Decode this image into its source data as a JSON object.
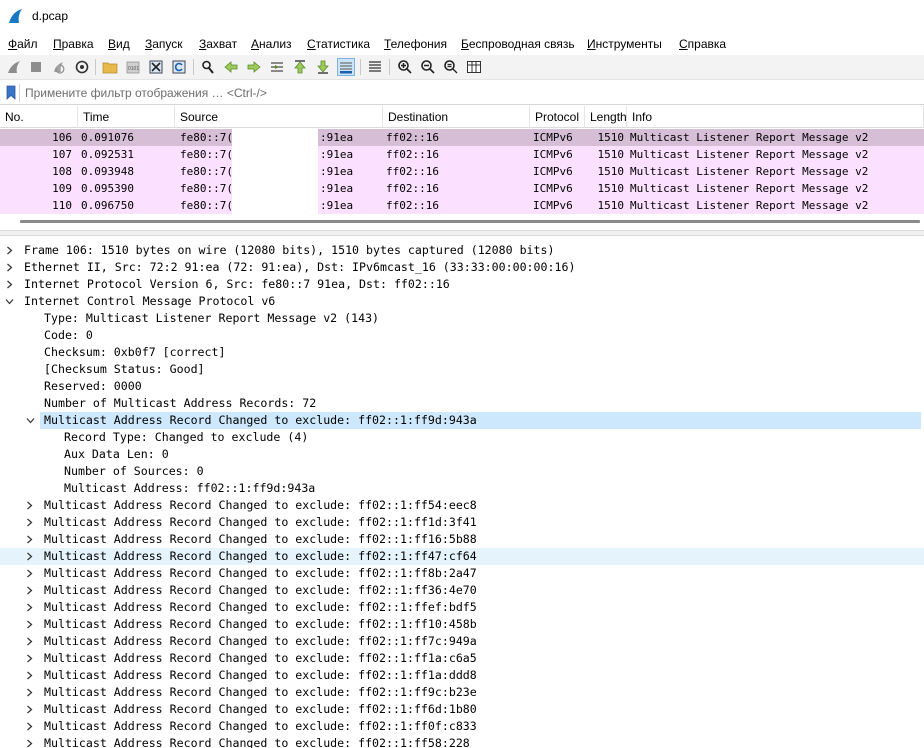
{
  "window": {
    "title": "d.pcap"
  },
  "menu": [
    "Файл",
    "Правка",
    "Вид",
    "Запуск",
    "Захват",
    "Анализ",
    "Статистика",
    "Телефония",
    "Беспроводная связь",
    "Инструменты",
    "Справка"
  ],
  "toolbar_icons": [
    "start-capture-icon",
    "stop-capture-icon",
    "restart-capture-icon",
    "capture-options-icon",
    "open-file-icon",
    "save-file-icon",
    "close-file-icon",
    "reload-file-icon",
    "find-packet-icon",
    "go-back-icon",
    "go-forward-icon",
    "go-to-packet-icon",
    "first-packet-icon",
    "last-packet-icon",
    "autoscroll-icon",
    "colorize-icon",
    "zoom-in-icon",
    "zoom-out-icon",
    "normal-size-icon",
    "resize-columns-icon"
  ],
  "filter": {
    "placeholder": "Примените фильтр отображения … <Ctrl-/>"
  },
  "packet_list": {
    "columns": [
      "No.",
      "Time",
      "Source",
      "Destination",
      "Protocol",
      "Length",
      "Info"
    ],
    "rows": [
      {
        "no": "106",
        "time": "0.091076",
        "source_start": "fe80::7(",
        "source_end": ":91ea",
        "destination": "ff02::16",
        "protocol": "ICMPv6",
        "length": "1510",
        "info": "Multicast Listener Report Message v2",
        "selected": true
      },
      {
        "no": "107",
        "time": "0.092531",
        "source_start": "fe80::7(",
        "source_end": ":91ea",
        "destination": "ff02::16",
        "protocol": "ICMPv6",
        "length": "1510",
        "info": "Multicast Listener Report Message v2",
        "selected": false
      },
      {
        "no": "108",
        "time": "0.093948",
        "source_start": "fe80::7(",
        "source_end": ":91ea",
        "destination": "ff02::16",
        "protocol": "ICMPv6",
        "length": "1510",
        "info": "Multicast Listener Report Message v2",
        "selected": false
      },
      {
        "no": "109",
        "time": "0.095390",
        "source_start": "fe80::7(",
        "source_end": ":91ea",
        "destination": "ff02::16",
        "protocol": "ICMPv6",
        "length": "1510",
        "info": "Multicast Listener Report Message v2",
        "selected": false
      },
      {
        "no": "110",
        "time": "0.096750",
        "source_start": "fe80::7(",
        "source_end": ":91ea",
        "destination": "ff02::16",
        "protocol": "ICMPv6",
        "length": "1510",
        "info": "Multicast Listener Report Message v2",
        "selected": false
      }
    ]
  },
  "details": [
    {
      "level": 0,
      "arrow": "right",
      "highlight": "",
      "text": "Frame 106: 1510 bytes on wire (12080 bits), 1510 bytes captured (12080 bits)"
    },
    {
      "level": 0,
      "arrow": "right",
      "highlight": "",
      "text": "Ethernet II, Src: 72:2           91:ea (72:           91:ea), Dst: IPv6mcast_16 (33:33:00:00:00:16)"
    },
    {
      "level": 0,
      "arrow": "right",
      "highlight": "",
      "text": "Internet Protocol Version 6, Src: fe80::7                  91ea, Dst: ff02::16"
    },
    {
      "level": 0,
      "arrow": "down",
      "highlight": "",
      "text": "Internet Control Message Protocol v6"
    },
    {
      "level": 1,
      "arrow": "",
      "highlight": "",
      "text": "Type: Multicast Listener Report Message v2 (143)"
    },
    {
      "level": 1,
      "arrow": "",
      "highlight": "",
      "text": "Code: 0"
    },
    {
      "level": 1,
      "arrow": "",
      "highlight": "",
      "text": "Checksum: 0xb0f7 [correct]"
    },
    {
      "level": 1,
      "arrow": "",
      "highlight": "",
      "text": "[Checksum Status: Good]"
    },
    {
      "level": 1,
      "arrow": "",
      "highlight": "",
      "text": "Reserved: 0000"
    },
    {
      "level": 1,
      "arrow": "",
      "highlight": "",
      "text": "Number of Multicast Address Records: 72"
    },
    {
      "level": 1,
      "arrow": "down",
      "highlight": "selected",
      "text": "Multicast Address Record Changed to exclude: ff02::1:ff9d:943a"
    },
    {
      "level": 2,
      "arrow": "",
      "highlight": "",
      "text": "Record Type: Changed to exclude (4)"
    },
    {
      "level": 2,
      "arrow": "",
      "highlight": "",
      "text": "Aux Data Len: 0"
    },
    {
      "level": 2,
      "arrow": "",
      "highlight": "",
      "text": "Number of Sources: 0"
    },
    {
      "level": 2,
      "arrow": "",
      "highlight": "",
      "text": "Multicast Address: ff02::1:ff9d:943a"
    },
    {
      "level": 1,
      "arrow": "right",
      "highlight": "",
      "text": "Multicast Address Record Changed to exclude: ff02::1:ff54:eec8"
    },
    {
      "level": 1,
      "arrow": "right",
      "highlight": "",
      "text": "Multicast Address Record Changed to exclude: ff02::1:ff1d:3f41"
    },
    {
      "level": 1,
      "arrow": "right",
      "highlight": "",
      "text": "Multicast Address Record Changed to exclude: ff02::1:ff16:5b88"
    },
    {
      "level": 1,
      "arrow": "right",
      "highlight": "hover",
      "text": "Multicast Address Record Changed to exclude: ff02::1:ff47:cf64"
    },
    {
      "level": 1,
      "arrow": "right",
      "highlight": "",
      "text": "Multicast Address Record Changed to exclude: ff02::1:ff8b:2a47"
    },
    {
      "level": 1,
      "arrow": "right",
      "highlight": "",
      "text": "Multicast Address Record Changed to exclude: ff02::1:ff36:4e70"
    },
    {
      "level": 1,
      "arrow": "right",
      "highlight": "",
      "text": "Multicast Address Record Changed to exclude: ff02::1:ffef:bdf5"
    },
    {
      "level": 1,
      "arrow": "right",
      "highlight": "",
      "text": "Multicast Address Record Changed to exclude: ff02::1:ff10:458b"
    },
    {
      "level": 1,
      "arrow": "right",
      "highlight": "",
      "text": "Multicast Address Record Changed to exclude: ff02::1:ff7c:949a"
    },
    {
      "level": 1,
      "arrow": "right",
      "highlight": "",
      "text": "Multicast Address Record Changed to exclude: ff02::1:ff1a:c6a5"
    },
    {
      "level": 1,
      "arrow": "right",
      "highlight": "",
      "text": "Multicast Address Record Changed to exclude: ff02::1:ff1a:ddd8"
    },
    {
      "level": 1,
      "arrow": "right",
      "highlight": "",
      "text": "Multicast Address Record Changed to exclude: ff02::1:ff9c:b23e"
    },
    {
      "level": 1,
      "arrow": "right",
      "highlight": "",
      "text": "Multicast Address Record Changed to exclude: ff02::1:ff6d:1b80"
    },
    {
      "level": 1,
      "arrow": "right",
      "highlight": "",
      "text": "Multicast Address Record Changed to exclude: ff02::1:ff0f:c833"
    },
    {
      "level": 1,
      "arrow": "right",
      "highlight": "",
      "text": "Multicast Address Record Changed to exclude: ff02::1:ff58:228"
    }
  ],
  "colors": {
    "row_bg": "#fce0ff",
    "row_selected_bg": "#d6bed6",
    "detail_selected_bg": "#cde8fc",
    "detail_hover_bg": "#e5f3fd"
  }
}
